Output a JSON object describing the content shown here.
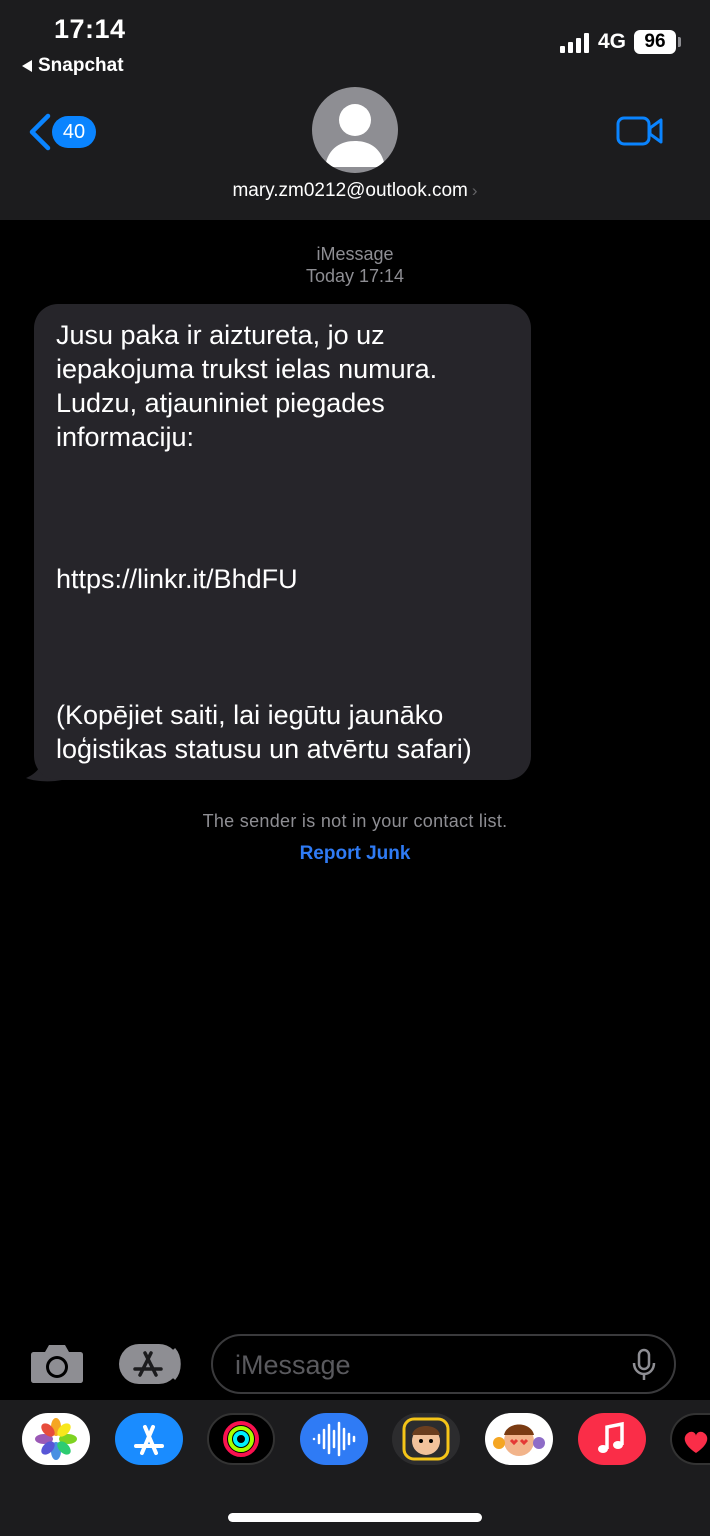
{
  "status_bar": {
    "time": "17:14",
    "back_app": "Snapchat",
    "network": "4G",
    "battery": "96"
  },
  "header": {
    "unread_count": "40",
    "contact": "mary.zm0212@outlook.com"
  },
  "conversation": {
    "service": "iMessage",
    "timestamp": "Today 17:14",
    "message": {
      "body": "Jusu paka ir aiztureta, jo uz iepakojuma trukst ielas numura. Ludzu, atjauniniet piegades informaciju:",
      "link": "https://linkr.it/BhdFU",
      "footer": "(Kopējiet saiti, lai iegūtu jaunāko loģistikas statusu un atvērtu safari)"
    },
    "notice": "The sender is not in your contact list.",
    "report_junk": "Report Junk"
  },
  "composer": {
    "placeholder": "iMessage"
  },
  "app_drawer": {
    "apps": [
      "photos-icon",
      "app-store-icon",
      "activity-icon",
      "voice-memo-icon",
      "memoji-icon",
      "animoji-icon",
      "music-icon",
      "digital-touch-icon"
    ]
  },
  "colors": {
    "accent": "#0a84ff",
    "bubble": "#26252a",
    "header": "#1c1c1e"
  }
}
